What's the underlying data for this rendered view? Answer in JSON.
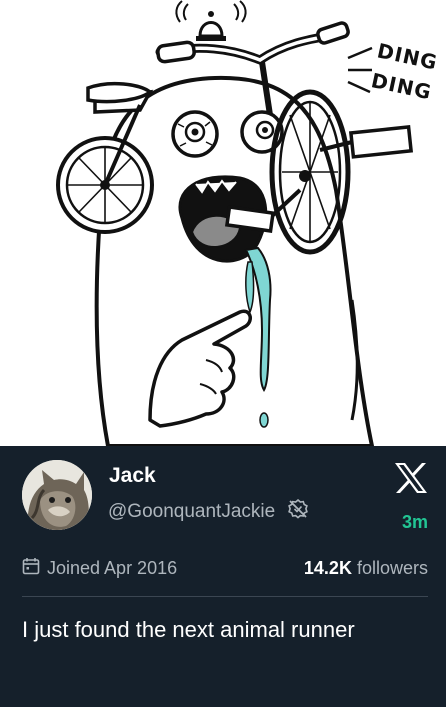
{
  "illustration": {
    "sound_effect": [
      "DING",
      "DING"
    ],
    "colors": {
      "ink": "#111111",
      "drool": "#7fd6d3",
      "mouth": "#111111",
      "tongue": "#8a8a8a"
    }
  },
  "profile": {
    "name": "Jack",
    "handle": "@GoonquantJackie",
    "joined": "Joined Apr 2016",
    "followers_count": "14.2K",
    "followers_label": "followers",
    "time_ago": "3m"
  },
  "tweet": {
    "text": "I just found the next animal runner"
  },
  "icons": [
    "x-logo-icon",
    "calendar-icon",
    "verified-off-icon",
    "bell-icon"
  ],
  "colors": {
    "card_background": "#15202b",
    "text_primary": "#ffffff",
    "text_secondary": "#aeb6bd",
    "accent_green": "#22c594"
  }
}
